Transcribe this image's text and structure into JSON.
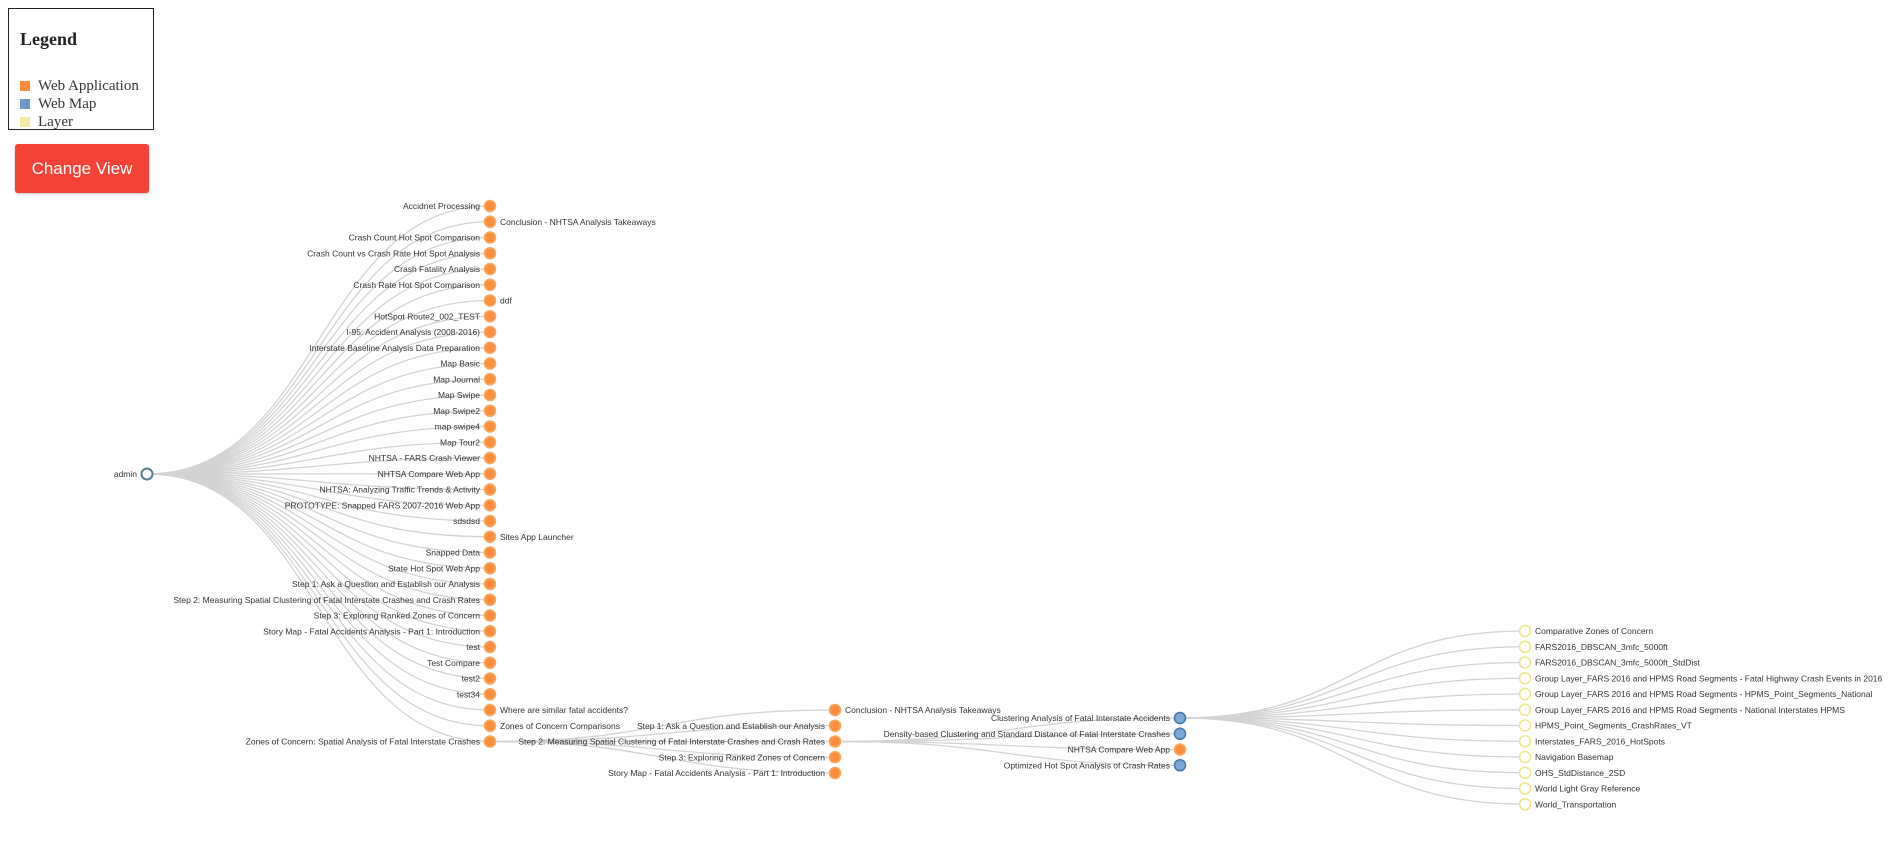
{
  "legend": {
    "title": "Legend",
    "items": [
      {
        "label": "Web Application",
        "color": "#fd8d3c"
      },
      {
        "label": "Web Map",
        "color": "#6b9bc8"
      },
      {
        "label": "Layer",
        "color": "#f6e9a4"
      }
    ]
  },
  "change_view_label": "Change View",
  "colors": {
    "web_app_fill": "#fd8d3c",
    "web_app_stroke": "#f5a862",
    "web_map_fill": "#7ba8d4",
    "web_map_stroke": "#4a78a8",
    "layer_fill": "#ffffff",
    "layer_stroke": "#efe58a",
    "root_stroke": "#5a7f8f",
    "link": "#d3d3d3"
  },
  "tree": {
    "root": "admin",
    "children": [
      {
        "label": "Accidnet Processing",
        "type": "app"
      },
      {
        "label": "Conclusion - NHTSA Analysis Takeaways",
        "type": "app"
      },
      {
        "label": "Crash Count Hot Spot Comparison",
        "type": "app"
      },
      {
        "label": "Crash Count vs Crash Rate Hot Spot Analysis",
        "type": "app"
      },
      {
        "label": "Crash Fatality Analysis",
        "type": "app"
      },
      {
        "label": "Crash Rate Hot Spot Comparison",
        "type": "app"
      },
      {
        "label": "ddf",
        "type": "app"
      },
      {
        "label": "HotSpot Route2_002_TEST",
        "type": "app"
      },
      {
        "label": "I-95: Accident Analysis (2008-2016)",
        "type": "app"
      },
      {
        "label": "Interstate Baseline Analysis Data Preparation",
        "type": "app"
      },
      {
        "label": "Map Basic",
        "type": "app"
      },
      {
        "label": "Map Journal",
        "type": "app"
      },
      {
        "label": "Map Swipe",
        "type": "app"
      },
      {
        "label": "Map Swipe2",
        "type": "app"
      },
      {
        "label": "map swipe4",
        "type": "app"
      },
      {
        "label": "Map Tour2",
        "type": "app"
      },
      {
        "label": "NHTSA - FARS Crash Viewer",
        "type": "app"
      },
      {
        "label": "NHTSA Compare Web App",
        "type": "app"
      },
      {
        "label": "NHTSA: Analyzing Traffic Trends & Activity",
        "type": "app"
      },
      {
        "label": "PROTOTYPE: Snapped FARS 2007-2016 Web App",
        "type": "app"
      },
      {
        "label": "sdsdsd",
        "type": "app"
      },
      {
        "label": "Sites App Launcher",
        "type": "app"
      },
      {
        "label": "Snapped Data",
        "type": "app"
      },
      {
        "label": "State Hot Spot Web App",
        "type": "app"
      },
      {
        "label": "Step 1: Ask a Question and Establish our Analysis",
        "type": "app"
      },
      {
        "label": "Step 2: Measuring Spatial Clustering of Fatal Interstate Crashes and Crash Rates",
        "type": "app"
      },
      {
        "label": "Step 3: Exploring Ranked Zones of Concern",
        "type": "app"
      },
      {
        "label": "Story Map - Fatal Accidents Analysis - Part 1: Introduction",
        "type": "app"
      },
      {
        "label": "test",
        "type": "app"
      },
      {
        "label": "Test Compare",
        "type": "app"
      },
      {
        "label": "test2",
        "type": "app"
      },
      {
        "label": "test34",
        "type": "app"
      },
      {
        "label": "Where are similar fatal accidents?",
        "type": "app"
      },
      {
        "label": "Zones of Concern Comparisons",
        "type": "app"
      },
      {
        "label": "Zones of Concern: Spatial Analysis of Fatal Interstate Crashes",
        "type": "app",
        "children": [
          {
            "label": "Conclusion - NHTSA Analysis Takeaways",
            "type": "app"
          },
          {
            "label": "Step 1: Ask a Question and Establish our Analysis",
            "type": "app"
          },
          {
            "label": "Step 2: Measuring Spatial Clustering of Fatal Interstate Crashes and Crash Rates",
            "type": "app",
            "children": [
              {
                "label": "Clustering Analysis of Fatal Interstate Accidents",
                "type": "map",
                "children": [
                  {
                    "label": "Comparative Zones of Concern",
                    "type": "layer"
                  },
                  {
                    "label": "FARS2016_DBSCAN_3mfc_5000ft",
                    "type": "layer"
                  },
                  {
                    "label": "FARS2016_DBSCAN_3mfc_5000ft_StdDist",
                    "type": "layer"
                  },
                  {
                    "label": "Group Layer_FARS 2016 and HPMS Road Segments - Fatal Highway Crash Events in 2016",
                    "type": "layer"
                  },
                  {
                    "label": "Group Layer_FARS 2016 and HPMS Road Segments - HPMS_Point_Segments_National",
                    "type": "layer"
                  },
                  {
                    "label": "Group Layer_FARS 2016 and HPMS Road Segments - National Interstates HPMS",
                    "type": "layer"
                  },
                  {
                    "label": "HPMS_Point_Segments_CrashRates_VT",
                    "type": "layer"
                  },
                  {
                    "label": "Interstates_FARS_2016_HotSpots",
                    "type": "layer"
                  },
                  {
                    "label": "Navigation Basemap",
                    "type": "layer"
                  },
                  {
                    "label": "OHS_StdDistance_2SD",
                    "type": "layer"
                  },
                  {
                    "label": "World Light Gray Reference",
                    "type": "layer"
                  },
                  {
                    "label": "World_Transportation",
                    "type": "layer"
                  }
                ]
              },
              {
                "label": "Density-based Clustering and Standard Distance of Fatal Interstate Crashes",
                "type": "map"
              },
              {
                "label": "NHTSA Compare Web App",
                "type": "app"
              },
              {
                "label": "Optimized Hot Spot Analysis of Crash Rates",
                "type": "map"
              }
            ]
          },
          {
            "label": "Step 3: Exploring Ranked Zones of Concern",
            "type": "app"
          },
          {
            "label": "Story Map - Fatal Accidents Analysis - Part 1: Introduction",
            "type": "app"
          }
        ]
      }
    ]
  }
}
